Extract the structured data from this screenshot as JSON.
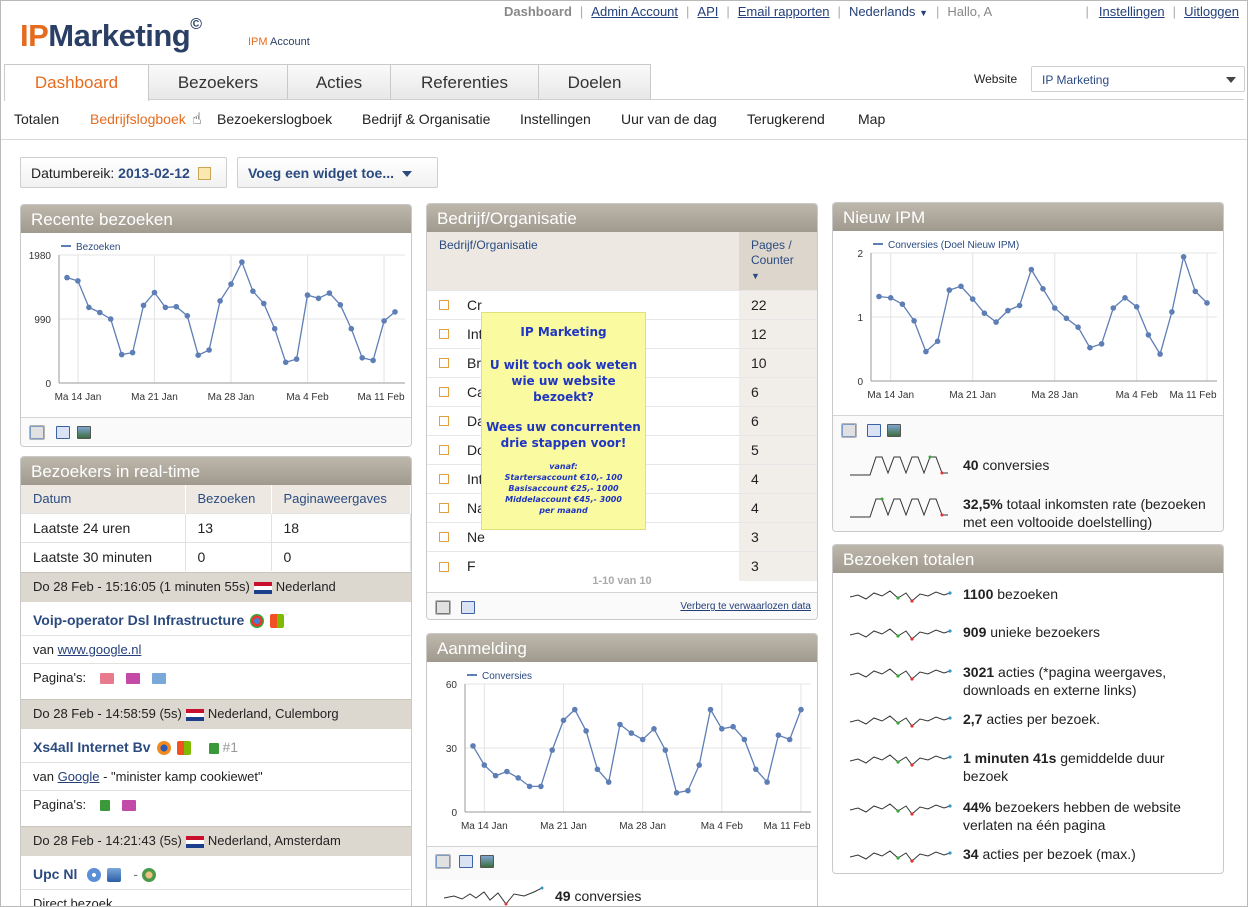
{
  "topnav": {
    "dashboard": "Dashboard",
    "admin": "Admin Account",
    "api": "API",
    "email": "Email rapporten",
    "language": "Nederlands",
    "greeting": "Hallo, A",
    "settings": "Instellingen",
    "logout": "Uitloggen"
  },
  "logo": {
    "ip": "IP",
    "marketing": "Marketing",
    "mark": "©",
    "sub_ipm": "IPM",
    "sub_account": "Account"
  },
  "tabs": [
    "Dashboard",
    "Bezoekers",
    "Acties",
    "Referenties",
    "Doelen"
  ],
  "website": {
    "label": "Website",
    "value": "IP Marketing"
  },
  "subnav": [
    "Totalen",
    "Bedrijfslogboek",
    "Bezoekerslogboek",
    "Bedrijf & Organisatie",
    "Instellingen",
    "Uur van de dag",
    "Terugkerend",
    "Map"
  ],
  "controls": {
    "date_label": "Datumbereik:",
    "date_value": "2013-02-12",
    "add_widget": "Voeg een widget toe..."
  },
  "colors": {
    "accent": "#e56b1f",
    "brand": "#2b3f66",
    "link": "#24407a",
    "line": "#5e7eb6",
    "header": "#aaa49a"
  },
  "recent": {
    "title": "Recente bezoeken",
    "chart_data": {
      "type": "line",
      "series": [
        {
          "name": "Bezoeken",
          "values": [
            1630,
            1580,
            1170,
            1090,
            990,
            440,
            470,
            1200,
            1400,
            1170,
            1180,
            1040,
            430,
            510,
            1270,
            1530,
            1870,
            1420,
            1230,
            840,
            320,
            370,
            1360,
            1310,
            1390,
            1210,
            840,
            390,
            350,
            960,
            1100
          ]
        }
      ],
      "xticks": [
        "Ma 14 Jan",
        "Ma 21 Jan",
        "Ma 28 Jan",
        "Ma 4 Feb",
        "Ma 11 Feb"
      ],
      "yticks": [
        "1980",
        "990",
        "0"
      ],
      "ylim": [
        0,
        1980
      ]
    }
  },
  "realtime": {
    "title": "Bezoekers in real-time",
    "headers": [
      "Datum",
      "Bezoeken",
      "Paginaweergaves"
    ],
    "rows": [
      [
        "Laatste 24 uren",
        "13",
        "18"
      ],
      [
        "Laatste 30 minuten",
        "0",
        "0"
      ]
    ],
    "visits": [
      {
        "date": "Do 28 Feb - 15:16:05 (1 minuten 55s)",
        "location": "Nederland",
        "name": "Voip-operator Dsl Infrastructure",
        "ref_prefix": "van ",
        "ref_link": "www.google.nl",
        "ref_suffix": "",
        "pages_label": "Pagina's:"
      },
      {
        "date": "Do 28 Feb - 14:58:59 (5s)",
        "location": "Nederland, Culemborg",
        "name": "Xs4all Internet Bv",
        "extra": "#1",
        "ref_prefix": "van ",
        "ref_link": "Google",
        "ref_suffix": " - \"minister kamp cookiewet\"",
        "pages_label": "Pagina's:"
      },
      {
        "date": "Do 28 Feb - 14:21:43 (5s)",
        "location": "Nederland, Amsterdam",
        "name": "Upc Nl",
        "extra": "-",
        "ref_plain": "Direct bezoek"
      }
    ]
  },
  "bedrijf": {
    "title": "Bedrijf/Organisatie",
    "col_name": "Bedrijf/Organisatie",
    "col_count": "Pages / Counter",
    "rows": [
      {
        "name": "Cr",
        "count": "22"
      },
      {
        "name": "Int",
        "count": "12"
      },
      {
        "name": "Br",
        "count": "10"
      },
      {
        "name": "Ca",
        "count": "6"
      },
      {
        "name": "Da",
        "count": "6"
      },
      {
        "name": "Do",
        "count": "5"
      },
      {
        "name": "Int",
        "count": "4"
      },
      {
        "name": "Na",
        "count": "4"
      },
      {
        "name": "Ne",
        "count": "3"
      },
      {
        "name": "F",
        "count": "3"
      }
    ],
    "pagination": "1-10 van 10",
    "hide_link": "Verberg te verwaarlozen data"
  },
  "ad": {
    "title": "IP Marketing",
    "line1": "U wilt toch ook weten wie uw website bezoekt?",
    "line2": "Wees uw concurrenten drie stappen voor!",
    "from": "vanaf:",
    "starter": "Startersaccount €10,- 100",
    "basis": "Basisaccount €25,- 1000",
    "midden": "Middelaccount €45,- 3000",
    "per": "per maand"
  },
  "aanmelding": {
    "title": "Aanmelding",
    "chart_data": {
      "type": "line",
      "series": [
        {
          "name": "Conversies",
          "values": [
            31,
            22,
            17,
            19,
            16,
            12,
            12,
            29,
            43,
            48,
            38,
            20,
            14,
            41,
            37,
            34,
            39,
            29,
            9,
            10,
            22,
            48,
            39,
            40,
            34,
            20,
            14,
            36,
            34,
            48
          ]
        }
      ],
      "xticks": [
        "Ma 14 Jan",
        "Ma 21 Jan",
        "Ma 28 Jan",
        "Ma 4 Feb",
        "Ma 11 Feb"
      ],
      "yticks": [
        "60",
        "30",
        "0"
      ],
      "ylim": [
        0,
        60
      ]
    },
    "stat_value": "49",
    "stat_text": " conversies"
  },
  "nieuw": {
    "title": "Nieuw IPM",
    "chart_data": {
      "type": "line",
      "series": [
        {
          "name": "Conversies (Doel Nieuw IPM)",
          "values": [
            1.32,
            1.3,
            1.2,
            0.94,
            0.46,
            0.62,
            1.42,
            1.48,
            1.28,
            1.06,
            0.92,
            1.1,
            1.18,
            1.74,
            1.44,
            1.14,
            0.98,
            0.84,
            0.52,
            0.58,
            1.14,
            1.3,
            1.16,
            0.72,
            0.42,
            1.08,
            1.94,
            1.4,
            1.22
          ]
        }
      ],
      "xticks": [
        "Ma 14 Jan",
        "Ma 21 Jan",
        "Ma 28 Jan",
        "Ma 4 Feb",
        "Ma 11 Feb"
      ],
      "yticks": [
        "2",
        "1",
        "0"
      ],
      "ylim": [
        0,
        2
      ]
    },
    "stats": [
      {
        "value": "40",
        "text": " conversies"
      },
      {
        "value": "32,5%",
        "text": " totaal inkomsten rate (bezoeken met een voltooide doelstelling)"
      }
    ]
  },
  "totalen": {
    "title": "Bezoeken totalen",
    "stats": [
      {
        "value": "1100",
        "text": " bezoeken"
      },
      {
        "value": "909",
        "text": " unieke bezoekers"
      },
      {
        "value": "3021",
        "text": " acties (*pagina weergaves, downloads en externe links)"
      },
      {
        "value": "2,7",
        "text": " acties per bezoek."
      },
      {
        "value": "1 minuten 41s",
        "text": " gemiddelde duur bezoek"
      },
      {
        "value": "44%",
        "text": " bezoekers hebben de website verlaten na één pagina"
      },
      {
        "value": "34",
        "text": " acties per bezoek (max.)"
      }
    ]
  }
}
